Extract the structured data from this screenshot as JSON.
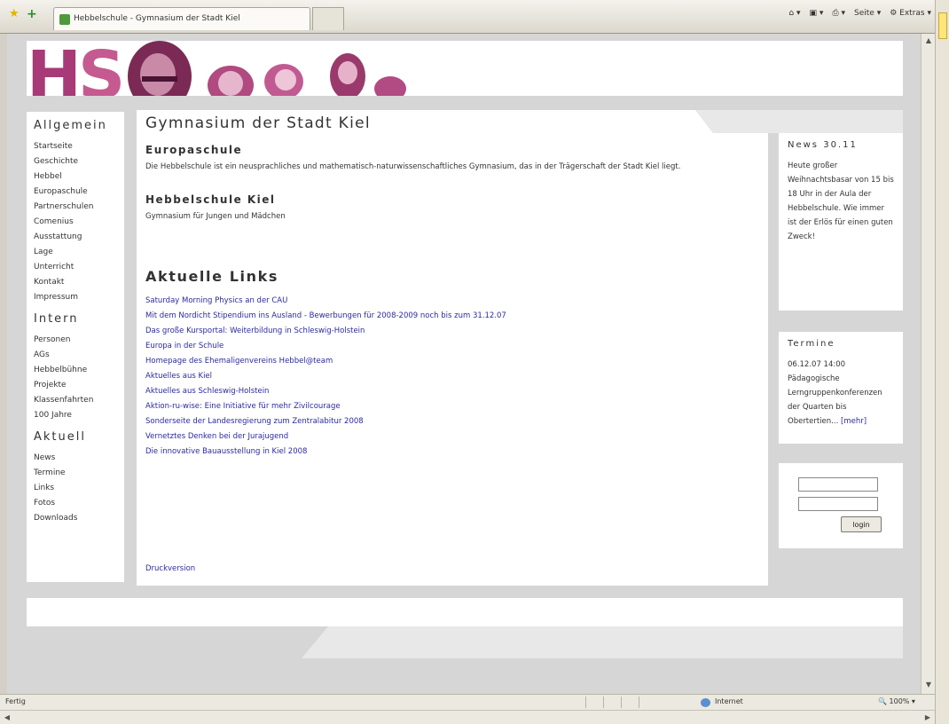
{
  "browser": {
    "tab_title": "Hebbelschule - Gymnasium der Stadt Kiel",
    "toolbar": [
      "Seite",
      "Extras"
    ]
  },
  "header": {
    "logo_text": "HS"
  },
  "nav": {
    "sections": [
      {
        "heading": "Allgemein",
        "items": [
          "Startseite",
          "Geschichte",
          "Hebbel",
          "Europaschule",
          "Partnerschulen",
          "Comenius",
          "Ausstattung",
          "Lage",
          "Unterricht",
          "Kontakt",
          "Impressum"
        ]
      },
      {
        "heading": "Intern",
        "items": [
          "Personen",
          "AGs",
          "Hebbelbühne",
          "Projekte",
          "Klassenfahrten",
          "100 Jahre"
        ]
      },
      {
        "heading": "Aktuell",
        "items": [
          "News",
          "Termine",
          "Links",
          "Fotos",
          "Downloads"
        ]
      }
    ]
  },
  "main": {
    "title": "Gymnasium der Stadt Kiel",
    "europaschule_heading": "Europaschule",
    "europaschule_text": "Die Hebbelschule ist ein neusprachliches und mathematisch-naturwissenschaftliches Gymnasium, das in der Trägerschaft der Stadt Kiel liegt.",
    "hebbel_heading": "Hebbelschule Kiel",
    "hebbel_text": "Gymnasium für Jungen und Mädchen",
    "links_heading": "Aktuelle Links",
    "links": [
      "Saturday Morning Physics an der CAU",
      "Mit dem Nordicht Stipendium ins Ausland - Bewerbungen für 2008-2009 noch bis zum 31.12.07",
      "Das große Kursportal: Weiterbildung in Schleswig-Holstein",
      "Europa in der Schule",
      "Homepage des Ehemaligenvereins Hebbel@team",
      "Aktuelles aus Kiel",
      "Aktuelles aus Schleswig-Holstein",
      "Aktion-ru-wise: Eine Initiative für mehr Zivilcourage",
      "Sonderseite der Landesregierung zum Zentralabitur 2008",
      "Vernetztes Denken bei der Jurajugend",
      "Die innovative Bauausstellung in Kiel 2008"
    ],
    "print_link": "Druckversion"
  },
  "news": {
    "heading": "News 30.11",
    "text": "Heute großer Weihnachtsbasar von 15 bis 18 Uhr in der Aula der Hebbelschule. Wie immer ist der Erlös für einen guten Zweck!"
  },
  "termine": {
    "heading": "Termine",
    "text": "06.12.07 14:00 Pädagogische Lerngruppenkonferenzen der Quarten bis Obertertien...",
    "more": "[mehr]"
  },
  "login": {
    "button": "login"
  },
  "statusbar": {
    "text": "Fertig",
    "zone": "Internet",
    "zoom": "100%"
  }
}
